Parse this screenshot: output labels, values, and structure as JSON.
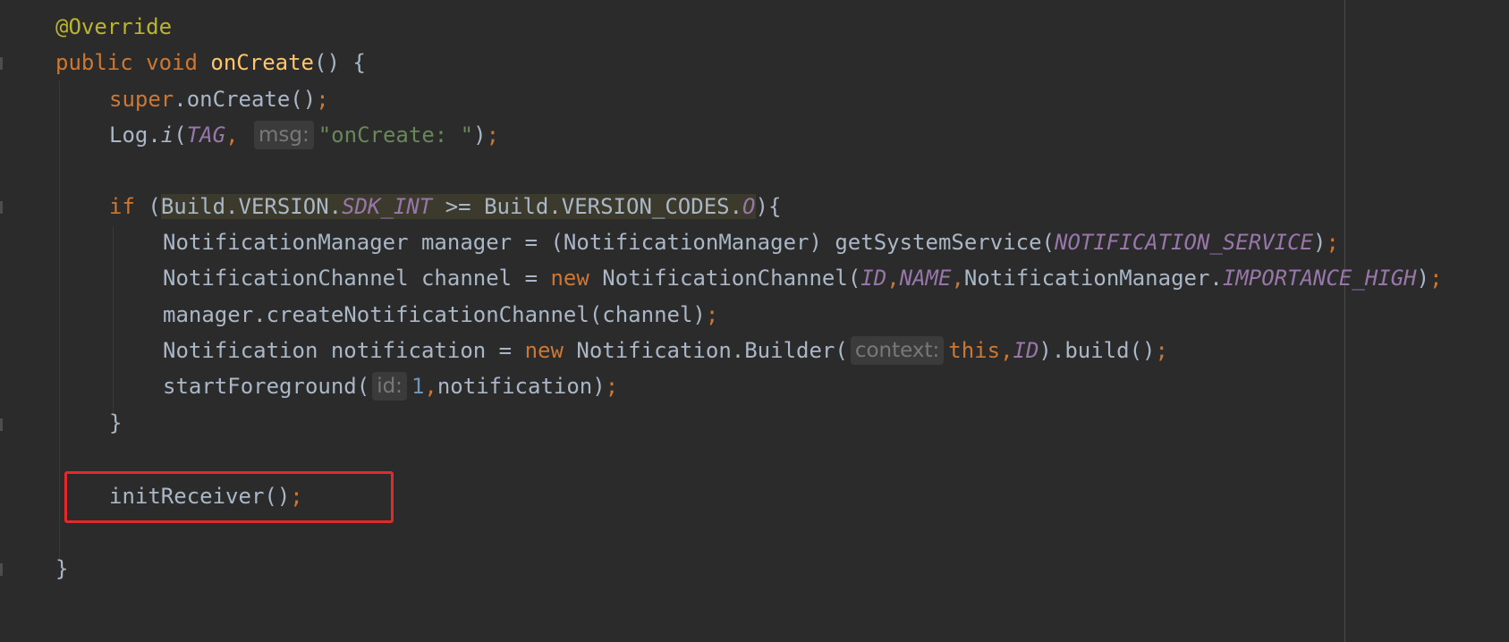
{
  "code": {
    "annotation": "@Override",
    "kw_public": "public",
    "kw_void": "void",
    "method_name": "onCreate",
    "method_tail": "() {",
    "kw_super": "super",
    "super_call": ".onCreate()",
    "semicolon": ";",
    "log_prefix": "Log.",
    "log_method": "i",
    "open_paren": "(",
    "tag_const": "TAG",
    "comma": ",",
    "hint_msg": "msg:",
    "log_string": "\"onCreate: \"",
    "close_paren": ")",
    "kw_if": "if",
    "if_open": " (",
    "cond_build": "Build.VERSION.",
    "cond_sdk": "SDK_INT",
    "cond_mid": " >= Build.VERSION_CODES.",
    "cond_o": "O",
    "if_close": "){",
    "manager_decl": "NotificationManager manager = (NotificationManager) getSystemService(",
    "notification_service": "NOTIFICATION_SERVICE",
    "channel_decl": "NotificationChannel channel = ",
    "kw_new": "new",
    "channel_ctor": " NotificationChannel(",
    "id_const": "ID",
    "name_const": "NAME",
    "nm_prefix": "NotificationManager.",
    "importance_high": "IMPORTANCE_HIGH",
    "create_channel": "manager.createNotificationChannel(channel)",
    "notification_decl": "Notification notification = ",
    "builder_call": " Notification.Builder(",
    "hint_context": "context:",
    "kw_this": "this",
    "build_call": ").build()",
    "start_fg": "startForeground(",
    "hint_id": "id:",
    "num_one": "1",
    "start_fg_tail": "notification)",
    "close_brace": "}",
    "init_receiver": "initReceiver()"
  },
  "colors": {
    "background": "#2b2b2b",
    "text": "#a9b7c6",
    "keyword": "#cc7832",
    "method_decl": "#ffc66d",
    "annotation": "#bbb529",
    "constant": "#9876aa",
    "string": "#6a8759",
    "number": "#6897bb",
    "highlight_box": "#e32a2a"
  }
}
